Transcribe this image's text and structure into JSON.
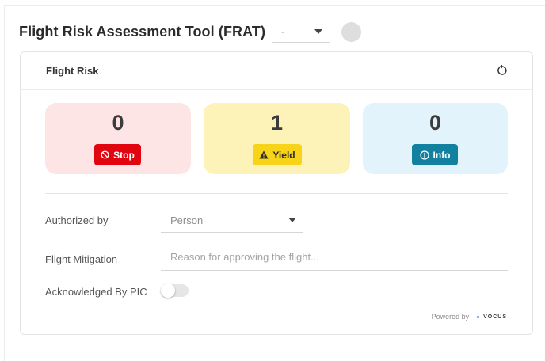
{
  "header": {
    "title": "Flight Risk Assessment Tool (FRAT)",
    "select_value": "-"
  },
  "card": {
    "title": "Flight Risk",
    "tiles": [
      {
        "count": "0",
        "label": "Stop",
        "icon": "prohibited-icon",
        "tile_color": "#fde5e5",
        "badge_color": "#e0050e"
      },
      {
        "count": "1",
        "label": "Yield",
        "icon": "warning-icon",
        "tile_color": "#fdf3b8",
        "badge_color": "#f7d31a"
      },
      {
        "count": "0",
        "label": "Info",
        "icon": "info-icon",
        "tile_color": "#e2f3fc",
        "badge_color": "#11819f"
      }
    ],
    "form": {
      "authorized_by_label": "Authorized by",
      "authorized_by_value": "Person",
      "mitigation_label": "Flight Mitigation",
      "mitigation_placeholder": "Reason for approving the flight...",
      "acknowledged_label": "Acknowledged By PIC",
      "acknowledged_on": false
    },
    "footer": {
      "powered_by": "Powered by",
      "brand": "VOCUS"
    }
  }
}
